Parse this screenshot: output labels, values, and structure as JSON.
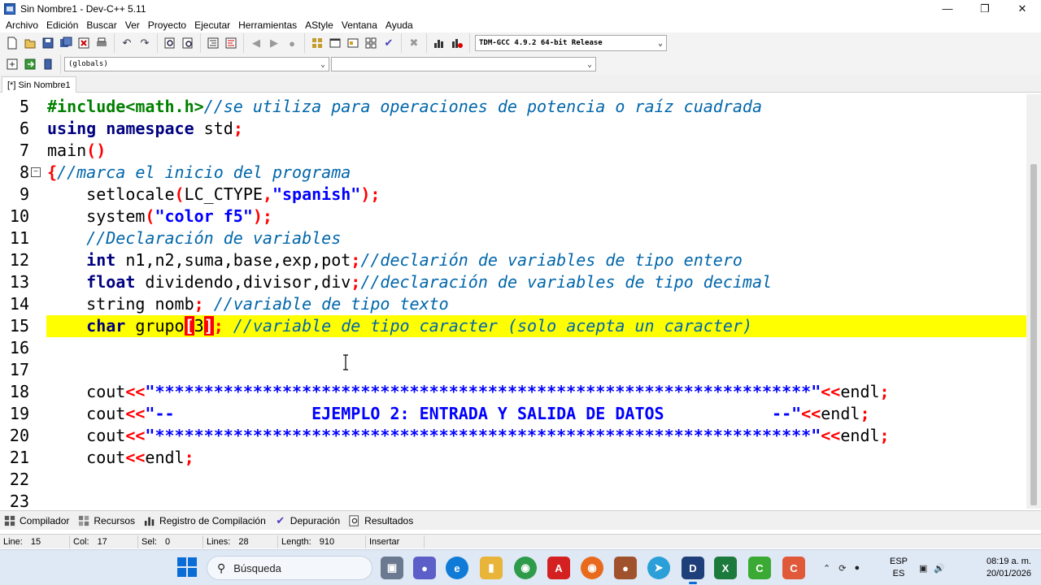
{
  "window": {
    "title": "Sin Nombre1 - Dev-C++ 5.11"
  },
  "menu": [
    "Archivo",
    "Edición",
    "Buscar",
    "Ver",
    "Proyecto",
    "Ejecutar",
    "Herramientas",
    "AStyle",
    "Ventana",
    "Ayuda"
  ],
  "toolbar": {
    "compiler": "TDM-GCC 4.9.2 64-bit Release",
    "scope": "(globals)",
    "member": ""
  },
  "editor": {
    "tab_label": "[*] Sin Nombre1",
    "highlighted_line": "15",
    "lines": [
      {
        "n": "5",
        "code": ""
      },
      {
        "n": "6",
        "code": ""
      },
      {
        "n": "7",
        "code": ""
      },
      {
        "n": "8",
        "code": ""
      },
      {
        "n": "9",
        "code": ""
      },
      {
        "n": "10",
        "code": ""
      },
      {
        "n": "11",
        "code": ""
      },
      {
        "n": "12",
        "code": ""
      },
      {
        "n": "13",
        "code": ""
      },
      {
        "n": "14",
        "code": ""
      },
      {
        "n": "15",
        "code": ""
      },
      {
        "n": "16",
        "code": ""
      },
      {
        "n": "17",
        "code": ""
      },
      {
        "n": "18",
        "code": ""
      },
      {
        "n": "19",
        "code": ""
      },
      {
        "n": "20",
        "code": ""
      },
      {
        "n": "21",
        "code": ""
      },
      {
        "n": "22",
        "code": ""
      },
      {
        "n": "23",
        "code": ""
      }
    ],
    "code": {
      "l5_pp": "#include<math.h>",
      "l5_cm": "//se utiliza para operaciones de potencia o raíz cuadrada",
      "l6_kw1": "using",
      "l6_kw2": "namespace",
      "l6_rest": " std",
      "l6_semi": ";",
      "l7_name": "main",
      "l7_par": "()",
      "l8_brace": "{",
      "l8_cm": "//marca el inicio del programa",
      "l9_fn": "    setlocale",
      "l9_p1": "(",
      "l9_arg": "LC_CTYPE",
      "l9_comma": ",",
      "l9_str": "\"spanish\"",
      "l9_end": ");",
      "l10_fn": "    system",
      "l10_p1": "(",
      "l10_str": "\"color f5\"",
      "l10_end": ");",
      "l11_cm": "    //Declaración de variables",
      "l12_kw": "    int",
      "l12_vars": " n1,n2,suma,base,exp,pot",
      "l12_semi": ";",
      "l12_cm": "//declarión de variables de tipo entero",
      "l13_kw": "    float",
      "l13_vars": " dividendo,divisor,div",
      "l13_semi": ";",
      "l13_cm": "//declaración de variables de tipo decimal",
      "l14_type": "    string nomb",
      "l14_semi": ";",
      "l14_cm": " //variable de tipo texto",
      "l15_kw": "    char",
      "l15_name": " grupo",
      "l15_lb": "[",
      "l15_num": "3",
      "l15_rb": "]",
      "l15_semi": ";",
      "l15_cm": " //variable de tipo caracter (solo acepta un caracter)",
      "l18_cout": "    cout",
      "l18_op": "<<",
      "l18_str": "\"*******************************************************************\"",
      "l18_op2": "<<",
      "l18_endl": "endl",
      "l18_semi": ";",
      "l19_cout": "    cout",
      "l19_op": "<<",
      "l19_str": "\"--              EJEMPLO 2: ENTRADA Y SALIDA DE DATOS           --\"",
      "l19_op2": "<<",
      "l19_endl": "endl",
      "l19_semi": ";",
      "l20_cout": "    cout",
      "l20_op": "<<",
      "l20_str": "\"*******************************************************************\"",
      "l20_op2": "<<",
      "l20_endl": "endl",
      "l20_semi": ";",
      "l21_cout": "    cout",
      "l21_op": "<<",
      "l21_endl": "endl",
      "l21_semi": ";"
    }
  },
  "panel_tabs": [
    "Compilador",
    "Recursos",
    "Registro de Compilación",
    "Depuración",
    "Resultados"
  ],
  "status": {
    "line_label": "Line:",
    "line": "15",
    "col_label": "Col:",
    "col": "17",
    "sel_label": "Sel:",
    "sel": "0",
    "lines_label": "Lines:",
    "lines": "28",
    "length_label": "Length:",
    "length": "910",
    "mode": "Insertar"
  },
  "taskbar": {
    "search_placeholder": "Búsqueda",
    "lang_1": "ESP",
    "lang_2": "ES",
    "time": "08:19 a. m.",
    "date": "20/01/2026"
  },
  "colors": {
    "highlight": "#ffff00",
    "keyword": "#000080",
    "comment": "#0066aa",
    "string": "#0000ff",
    "symbol": "#ff0000"
  }
}
